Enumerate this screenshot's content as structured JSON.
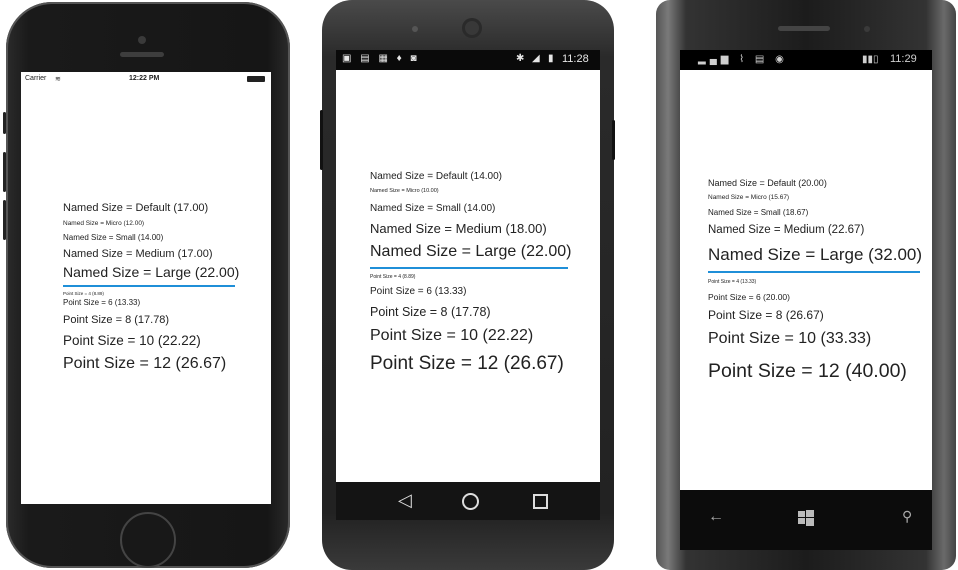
{
  "accent_color": "#1f8fd8",
  "iphone": {
    "status": {
      "carrier": "Carrier",
      "time": "12:22 PM"
    },
    "lines": [
      "Named Size = Default (17.00)",
      "Named Size = Micro (12.00)",
      "Named Size = Small (14.00)",
      "Named Size = Medium (17.00)",
      "Named Size = Large (22.00)",
      "Point Size = 4 (8.89)",
      "Point Size = 6 (13.33)",
      "Point Size = 8 (17.78)",
      "Point Size = 10 (22.22)",
      "Point Size = 12 (26.67)"
    ]
  },
  "android": {
    "status": {
      "time": "11:28"
    },
    "lines": [
      "Named Size = Default (14.00)",
      "Named Size = Micro (10.00)",
      "Named Size = Small (14.00)",
      "Named Size = Medium (18.00)",
      "Named Size = Large (22.00)",
      "Point Size = 4 (8.89)",
      "Point Size = 6 (13.33)",
      "Point Size = 8 (17.78)",
      "Point Size = 10 (22.22)",
      "Point Size = 12 (26.67)"
    ],
    "nav_icons": [
      "back-icon",
      "home-icon",
      "recents-icon"
    ]
  },
  "windows": {
    "status": {
      "time": "11:29"
    },
    "lines": [
      "Named Size = Default (20.00)",
      "Named Size = Micro (15.67)",
      "Named Size = Small (18.67)",
      "Named Size = Medium (22.67)",
      "Named Size = Large (32.00)",
      "Point Size = 4 (13.33)",
      "Point Size = 6 (20.00)",
      "Point Size = 8 (26.67)",
      "Point Size = 10 (33.33)",
      "Point Size = 12 (40.00)"
    ],
    "nav_icons": [
      "back-arrow-icon",
      "windows-start-icon",
      "search-icon"
    ]
  }
}
